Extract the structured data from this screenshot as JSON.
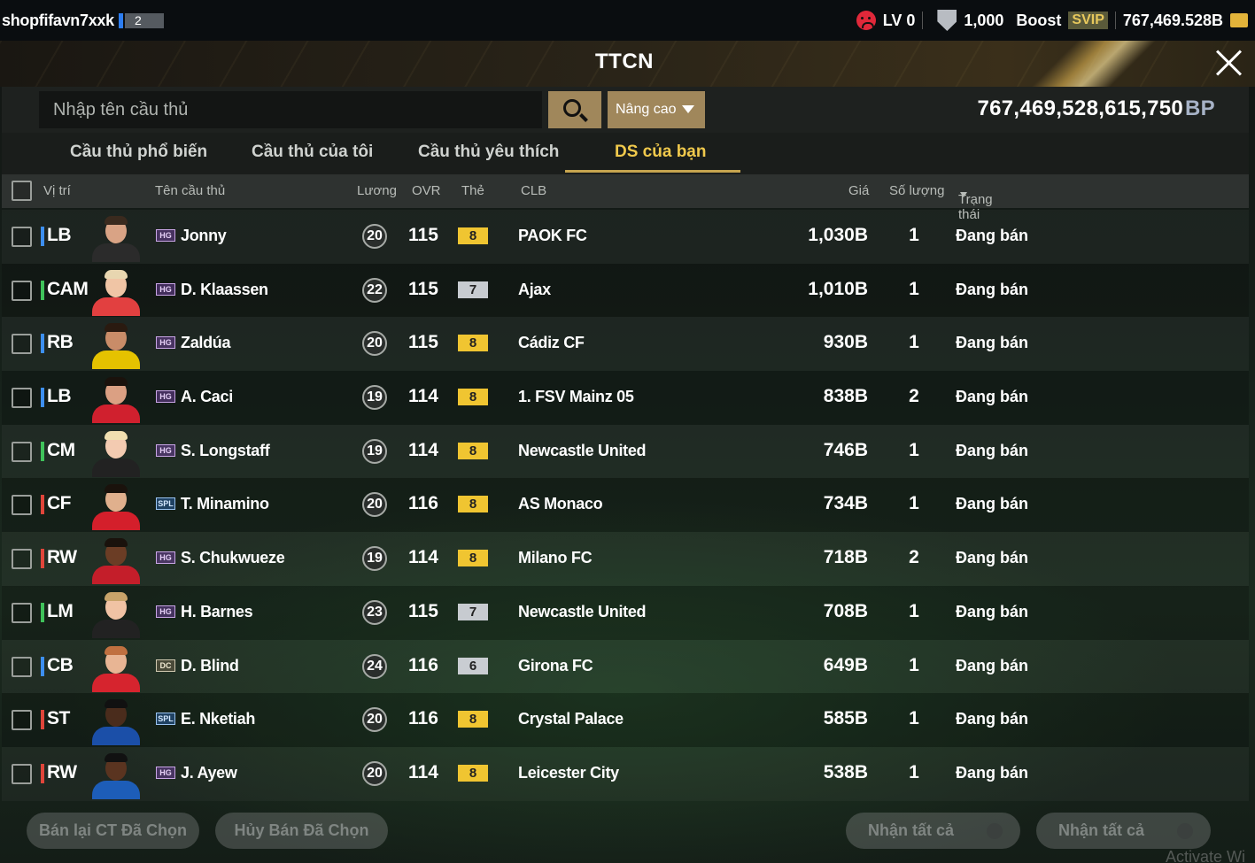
{
  "topbar": {
    "username": "shopfifavn7xxk",
    "user_level": "2",
    "lv": "LV 0",
    "shield_value": "1,000",
    "boost_label": "Boost",
    "svip_label": "SVIP",
    "balance": "767,469.528B"
  },
  "header": {
    "title": "TTCN"
  },
  "search": {
    "placeholder": "Nhập tên cầu thủ",
    "advanced_label": "Nâng cao",
    "bp_amount": "767,469,528,615,750",
    "bp_unit": "BP"
  },
  "tabs": [
    {
      "label": "Cầu thủ phổ biến",
      "active": false
    },
    {
      "label": "Cầu thủ của tôi",
      "active": false
    },
    {
      "label": "Cầu thủ yêu thích",
      "active": false
    },
    {
      "label": "DS của bạn",
      "active": true
    }
  ],
  "columns": {
    "position": "Vị trí",
    "name": "Tên cầu thủ",
    "wage": "Lương",
    "ovr": "OVR",
    "card": "Thẻ",
    "club": "CLB",
    "price": "Giá",
    "quantity": "Số lượng",
    "status": "Trạng thái"
  },
  "rows": [
    {
      "pos": "LB",
      "pos_color": "#3d8ff0",
      "season": "HG",
      "name": "Jonny",
      "wage": "20",
      "ovr": "115",
      "grade": "8",
      "club": "PAOK FC",
      "price": "1,030B",
      "qty": "1",
      "status": "Đang bán"
    },
    {
      "pos": "CAM",
      "pos_color": "#3fc25a",
      "season": "HG",
      "name": "D. Klaassen",
      "wage": "22",
      "ovr": "115",
      "grade": "7",
      "club": "Ajax",
      "price": "1,010B",
      "qty": "1",
      "status": "Đang bán"
    },
    {
      "pos": "RB",
      "pos_color": "#3d8ff0",
      "season": "HG",
      "name": "Zaldúa",
      "wage": "20",
      "ovr": "115",
      "grade": "8",
      "club": "Cádiz CF",
      "price": "930B",
      "qty": "1",
      "status": "Đang bán"
    },
    {
      "pos": "LB",
      "pos_color": "#3d8ff0",
      "season": "HG",
      "name": "A. Caci",
      "wage": "19",
      "ovr": "114",
      "grade": "8",
      "club": "1. FSV Mainz 05",
      "price": "838B",
      "qty": "2",
      "status": "Đang bán"
    },
    {
      "pos": "CM",
      "pos_color": "#3fc25a",
      "season": "HG",
      "name": "S. Longstaff",
      "wage": "19",
      "ovr": "114",
      "grade": "8",
      "club": "Newcastle United",
      "price": "746B",
      "qty": "1",
      "status": "Đang bán"
    },
    {
      "pos": "CF",
      "pos_color": "#e0453a",
      "season": "SPL",
      "name": "T. Minamino",
      "wage": "20",
      "ovr": "116",
      "grade": "8",
      "club": "AS Monaco",
      "price": "734B",
      "qty": "1",
      "status": "Đang bán"
    },
    {
      "pos": "RW",
      "pos_color": "#e0453a",
      "season": "HG",
      "name": "S. Chukwueze",
      "wage": "19",
      "ovr": "114",
      "grade": "8",
      "club": "Milano FC",
      "price": "718B",
      "qty": "2",
      "status": "Đang bán"
    },
    {
      "pos": "LM",
      "pos_color": "#3fc25a",
      "season": "HG",
      "name": "H. Barnes",
      "wage": "23",
      "ovr": "115",
      "grade": "7",
      "club": "Newcastle United",
      "price": "708B",
      "qty": "1",
      "status": "Đang bán"
    },
    {
      "pos": "CB",
      "pos_color": "#3d8ff0",
      "season": "DC",
      "name": "D. Blind",
      "wage": "24",
      "ovr": "116",
      "grade": "6",
      "club": "Girona FC",
      "price": "649B",
      "qty": "1",
      "status": "Đang bán"
    },
    {
      "pos": "ST",
      "pos_color": "#e0453a",
      "season": "SPL",
      "name": "E. Nketiah",
      "wage": "20",
      "ovr": "116",
      "grade": "8",
      "club": "Crystal Palace",
      "price": "585B",
      "qty": "1",
      "status": "Đang bán"
    },
    {
      "pos": "RW",
      "pos_color": "#e0453a",
      "season": "HG",
      "name": "J. Ayew",
      "wage": "20",
      "ovr": "114",
      "grade": "8",
      "club": "Leicester City",
      "price": "538B",
      "qty": "1",
      "status": "Đang bán"
    }
  ],
  "footer": {
    "resell_label": "Bán lại CT Đã Chọn",
    "cancel_label": "Hủy Bán Đã Chọn",
    "claim_all_players_label": "Nhận tất cả",
    "claim_all_bp_label": "Nhận tất cả",
    "watermark": "Activate Wi"
  },
  "colors": {
    "accent_gold": "#a0875b",
    "active_tab": "#f0c94c",
    "grade_gold": "#f0c531",
    "grade_silver": "#c7cbd0"
  }
}
